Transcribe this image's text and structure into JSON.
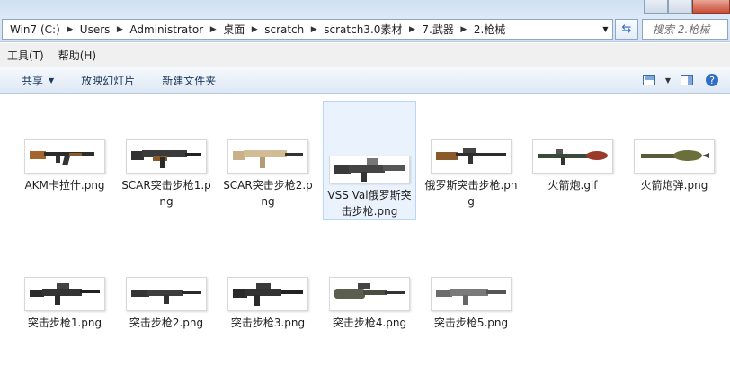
{
  "address": {
    "crumbs": [
      "Win7 (C:)",
      "Users",
      "Administrator",
      "桌面",
      "scratch",
      "scratch3.0素材",
      "7.武器",
      "2.枪械"
    ],
    "search_placeholder": "搜索 2.枪械"
  },
  "menu": [
    "工具(T)",
    "帮助(H)"
  ],
  "commands": {
    "share": "共享",
    "slideshow": "放映幻灯片",
    "new_folder": "新建文件夹"
  },
  "files": [
    {
      "name": "AKM卡拉什.png",
      "icon": "ak-rifle-thumb"
    },
    {
      "name": "SCAR突击步枪1.png",
      "icon": "scar-black-thumb"
    },
    {
      "name": "SCAR突击步枪2.png",
      "icon": "scar-tan-thumb"
    },
    {
      "name": "VSS Val俄罗斯突击步枪.png",
      "icon": "vss-rifle-thumb",
      "selected": true
    },
    {
      "name": "俄罗斯突击步枪.png",
      "icon": "russian-rifle-thumb"
    },
    {
      "name": "火箭炮.gif",
      "icon": "rpg-launcher-thumb"
    },
    {
      "name": "火箭炮弹.png",
      "icon": "rpg-rocket-thumb"
    },
    {
      "name": "突击步枪1.png",
      "icon": "rifle1-thumb"
    },
    {
      "name": "突击步枪2.png",
      "icon": "rifle2-thumb"
    },
    {
      "name": "突击步枪3.png",
      "icon": "rifle3-thumb"
    },
    {
      "name": "突击步枪4.png",
      "icon": "rifle4-thumb"
    },
    {
      "name": "突击步枪5.png",
      "icon": "rifle5-thumb"
    }
  ],
  "colors": {
    "selection": "#eaf3fd",
    "selection_border": "#b8d6fb",
    "toolbar": "#dde8f5"
  }
}
